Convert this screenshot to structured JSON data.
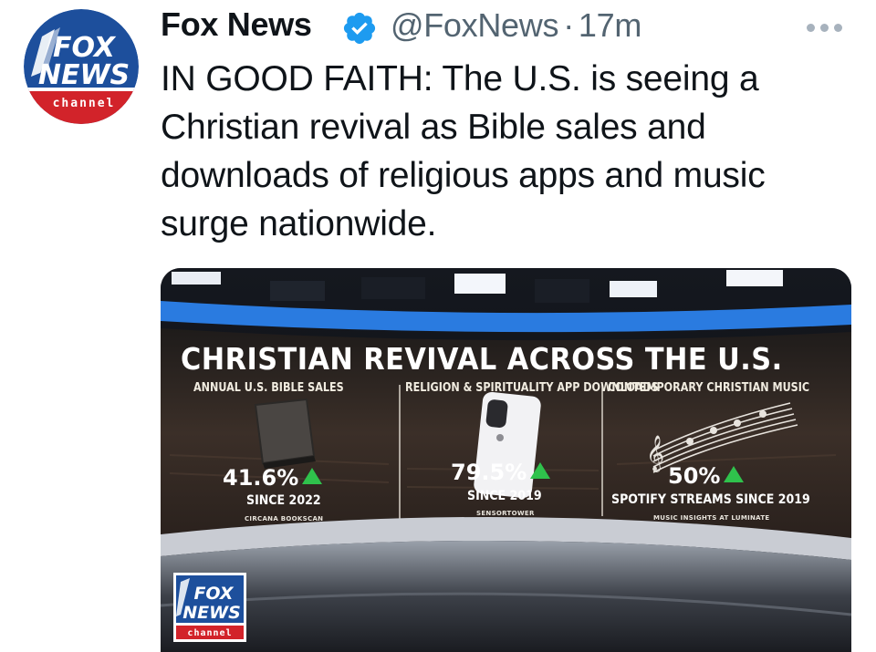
{
  "tweet": {
    "display_name": "Fox News",
    "handle": "@FoxNews",
    "separator": "·",
    "time": "17m",
    "text": "IN GOOD FAITH: The U.S. is seeing a Christian revival as Bible sales and downloads of religious apps and music surge nationwide.",
    "more_icon": "more-horizontal-icon",
    "verified_icon": "verified-badge-icon"
  },
  "avatar": {
    "line1": "FOX",
    "line2": "NEWS",
    "line3": "channel"
  },
  "graphic": {
    "headline": "CHRISTIAN REVIVAL ACROSS THE U.S.",
    "columns": [
      {
        "title": "ANNUAL U.S. BIBLE SALES",
        "value": "41.6%",
        "since": "SINCE 2022",
        "source": "CIRCANA BOOKSCAN"
      },
      {
        "title": "RELIGION & SPIRITUALITY APP DOWNLOADS",
        "value": "79.5%",
        "since": "SINCE 2019",
        "source": "SENSORTOWER"
      },
      {
        "title": "CONTEMPORARY CHRISTIAN MUSIC",
        "value": "50%",
        "since": "SPOTIFY STREAMS SINCE 2019",
        "source": "MUSIC INSIGHTS AT LUMINATE"
      }
    ],
    "logo": {
      "line1": "FOX",
      "line2": "NEWS",
      "line3": "channel"
    }
  },
  "colors": {
    "fox_blue": "#1d4f9c",
    "fox_red": "#d2232a",
    "verified_blue": "#1d9bf0",
    "up_green": "#2fc24c",
    "handle_gray": "#536471"
  }
}
